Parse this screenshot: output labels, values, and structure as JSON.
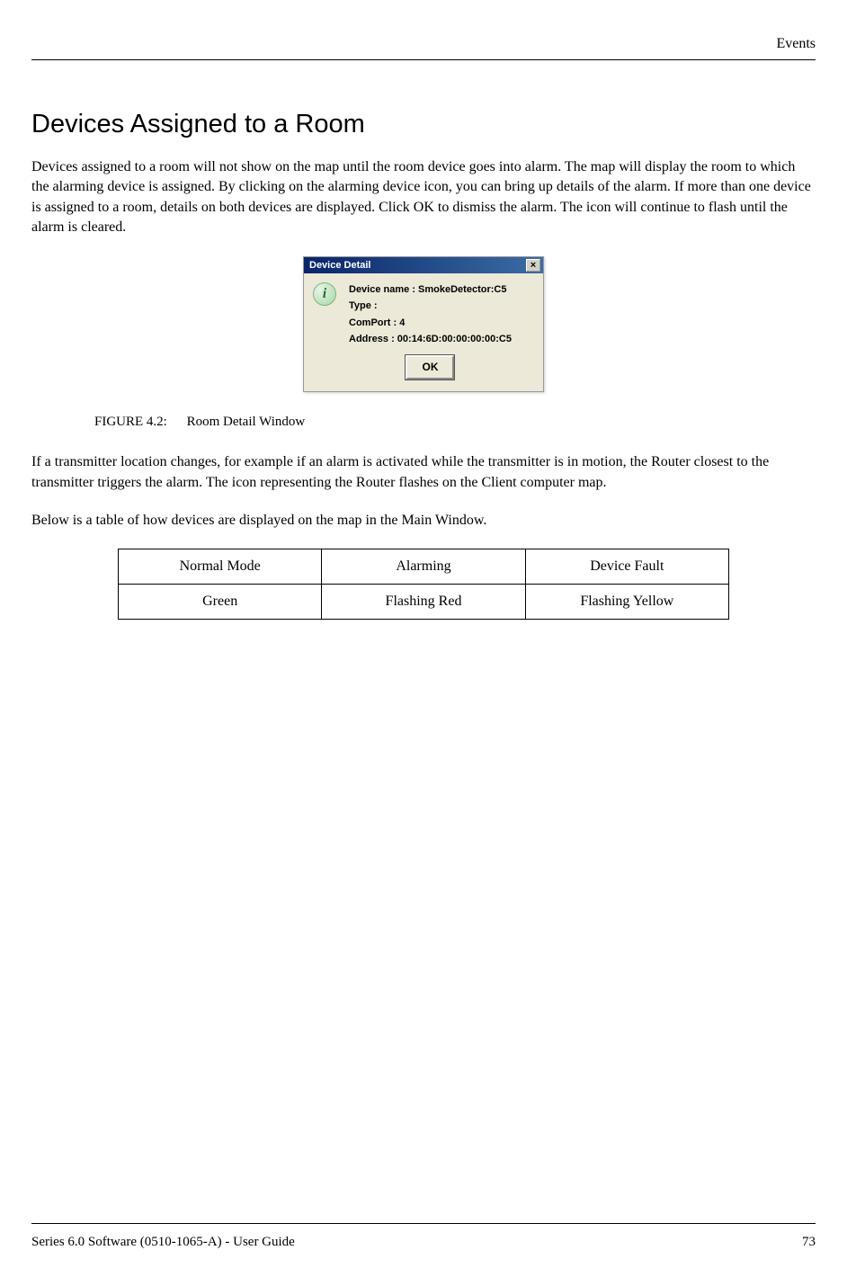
{
  "header": {
    "section": "Events"
  },
  "title": "Devices Assigned to a Room",
  "paragraph1": "Devices assigned to a room will not show on the map until the room device goes into alarm. The map will display the room to which the alarming device is assigned. By clicking on the alarming device icon, you can bring up details of the alarm. If more than one device is assigned to a room, details on both devices are displayed. Click OK to dismiss the alarm. The icon will continue to flash until the alarm is cleared.",
  "dialog": {
    "title": "Device Detail",
    "close_label": "×",
    "info_icon": "i",
    "lines": {
      "device_name": "Device name : SmokeDetector:C5",
      "type": "Type :",
      "comport": "ComPort : 4",
      "address": "Address : 00:14:6D:00:00:00:00:C5"
    },
    "ok_label": "OK"
  },
  "figure": {
    "label": "FIGURE 4.2:",
    "caption": "Room Detail Window"
  },
  "paragraph2": "If a transmitter location changes, for example if an alarm is activated while the transmitter is in motion, the Router closest to the transmitter triggers the alarm. The icon representing the Router flashes on the Client computer map.",
  "paragraph3": "Below is a table of how devices are displayed on the map in the Main Window.",
  "table": {
    "headers": [
      "Normal Mode",
      "Alarming",
      "Device Fault"
    ],
    "values": [
      "Green",
      "Flashing Red",
      "Flashing Yellow"
    ]
  },
  "footer": {
    "left": "Series 6.0 Software (0510-1065-A) - User Guide",
    "right": "73"
  }
}
